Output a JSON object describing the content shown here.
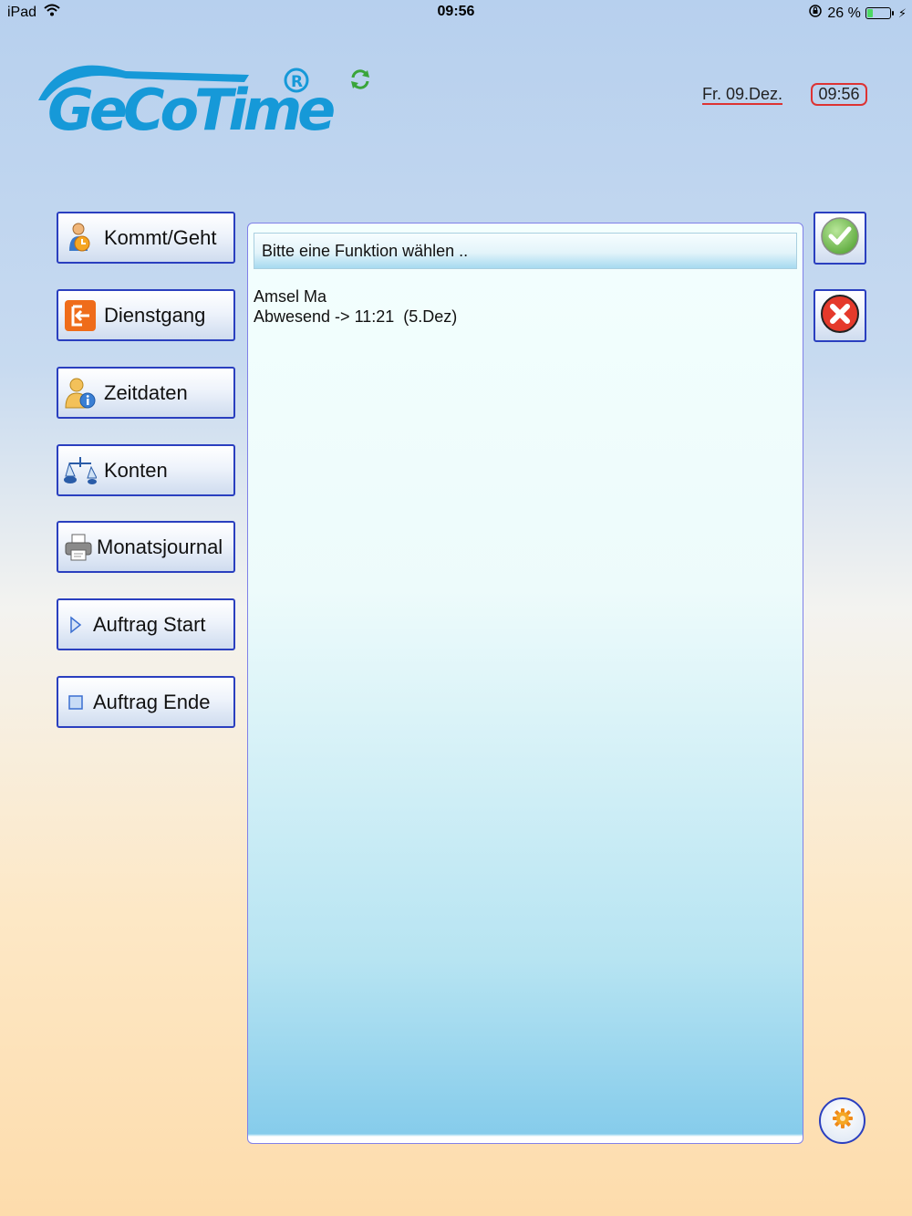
{
  "status_bar": {
    "device": "iPad",
    "time": "09:56",
    "battery_percent": "26 %",
    "battery_level": 0.26
  },
  "header": {
    "logo_text": "GeCoTime",
    "date": "Fr. 09.Dez.",
    "time": "09:56"
  },
  "menu": {
    "kommt_geht": "Kommt/Geht",
    "dienstgang": "Dienstgang",
    "zeitdaten": "Zeitdaten",
    "konten": "Konten",
    "monatsjournal": "Monatsjournal",
    "auftrag_start": "Auftrag Start",
    "auftrag_ende": "Auftrag Ende"
  },
  "panel": {
    "prompt": "Bitte eine Funktion wählen ..",
    "employee_name": "Amsel Ma",
    "status_line": "Abwesend -> 11:21  (5.Dez)"
  },
  "icons": {
    "confirm": "checkmark-icon",
    "cancel": "close-icon",
    "settings": "gear-icon",
    "sync": "sync-icon"
  },
  "colors": {
    "accent_border": "#2a3fbf",
    "logo_blue": "#1699d8",
    "date_underline": "#d33333",
    "confirm_green": "#6cc04a",
    "cancel_red": "#e53a2b"
  }
}
